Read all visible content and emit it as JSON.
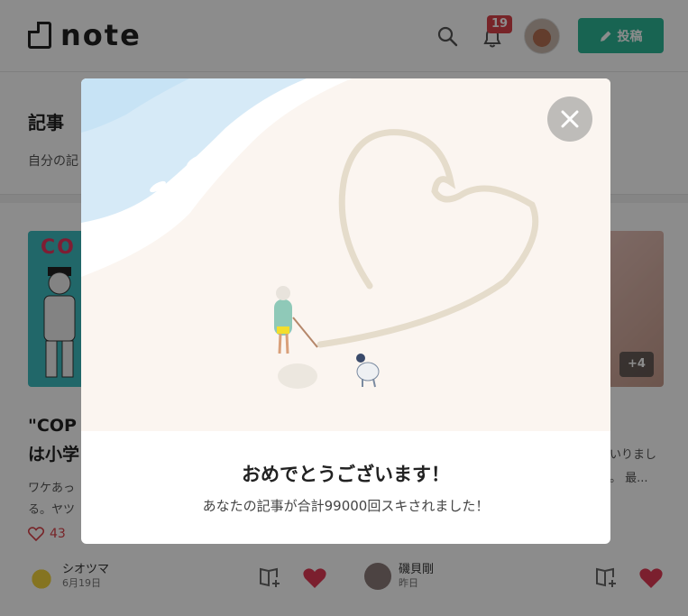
{
  "header": {
    "logo_text": "note",
    "notification_count": "19",
    "post_button_label": "投稿"
  },
  "section": {
    "title": "記事",
    "subtitle": "自分の記"
  },
  "cards": {
    "left": {
      "thumb_text": "CO",
      "title": "\"COP\nは小学",
      "excerpt": "ワケあっ\nる。ヤツ",
      "likes": "43",
      "author": "シオツマ",
      "date": "6月19日"
    },
    "right": {
      "more_badge": "+4",
      "excerpt": "いりまし\n。 最...",
      "author": "磯貝剛",
      "date": "昨日"
    }
  },
  "modal": {
    "title": "おめでとうございます！",
    "message": "あなたの記事が合計99000回スキされました！"
  },
  "colors": {
    "brand": "#2cb696",
    "badge": "#d9424a",
    "like": "#e03a55"
  },
  "icons": [
    "note-logo-icon",
    "search-icon",
    "bell-icon",
    "pencil-icon",
    "close-icon",
    "heart-icon",
    "magazine-add-icon"
  ]
}
